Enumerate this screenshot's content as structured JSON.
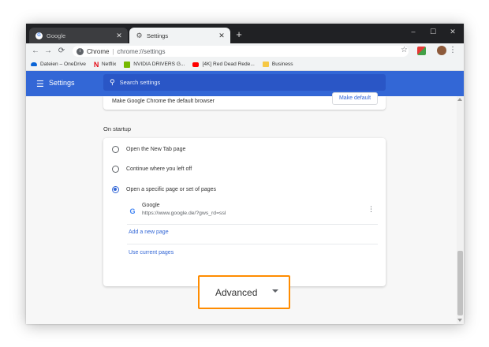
{
  "tabs": [
    {
      "title": "Google",
      "icon": "google-g-icon"
    },
    {
      "title": "Settings",
      "icon": "gear-icon",
      "active": true
    }
  ],
  "window_controls": {
    "minimize": "–",
    "maximize": "☐",
    "close": "✕"
  },
  "omnibox": {
    "site_label": "Chrome",
    "url": "chrome://settings"
  },
  "bookmarks": [
    {
      "label": "Dateien – OneDrive",
      "icon": "onedrive-icon",
      "color": "#0a64d6"
    },
    {
      "label": "Netflix",
      "icon": "netflix-icon",
      "color": "#e50914"
    },
    {
      "label": "NVIDIA DRIVERS G...",
      "icon": "nvidia-icon",
      "color": "#76b900"
    },
    {
      "label": "[4K] Red Dead Rede...",
      "icon": "youtube-icon",
      "color": "#ff0000"
    },
    {
      "label": "Business",
      "icon": "folder-icon",
      "color": "#f6c845"
    }
  ],
  "header": {
    "title": "Settings",
    "search_placeholder": "Search settings"
  },
  "default_browser": {
    "text": "Make Google Chrome the default browser",
    "button": "Make default"
  },
  "on_startup": {
    "title": "On startup",
    "options": [
      {
        "label": "Open the New Tab page",
        "checked": false
      },
      {
        "label": "Continue where you left off",
        "checked": false
      },
      {
        "label": "Open a specific page or set of pages",
        "checked": true
      }
    ],
    "page": {
      "name": "Google",
      "url": "https://www.google.de/?gws_rd=ssl"
    },
    "add_page": "Add a new page",
    "use_current": "Use current pages"
  },
  "advanced": {
    "label": "Advanced"
  },
  "colors": {
    "accent": "#3367d6",
    "highlight": "#ff8c00",
    "tabstrip": "#202124"
  }
}
